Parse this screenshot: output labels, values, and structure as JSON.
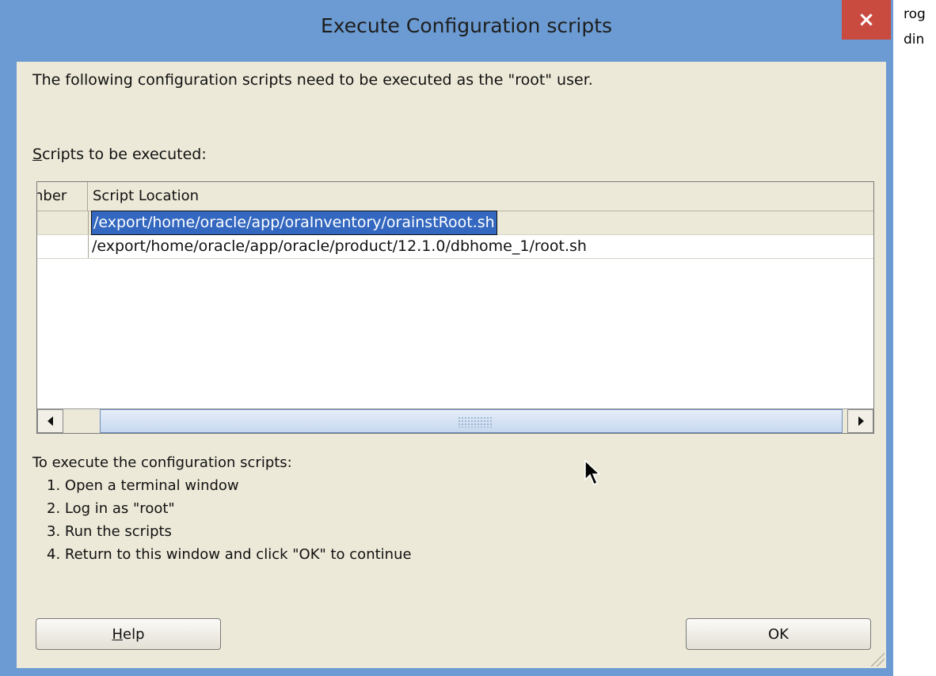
{
  "background_window": {
    "line1": "rog",
    "line2": "din"
  },
  "dialog": {
    "title": "Execute Configuration scripts",
    "close_label": "×",
    "message": "The following configuration scripts need to be executed as the \"root\" user.",
    "scripts_label_mnemonic": "S",
    "scripts_label_rest": "cripts to be executed:",
    "table": {
      "columns": [
        "nber",
        "Script Location"
      ],
      "rows": [
        {
          "number": "",
          "location": "/export/home/oracle/app/oraInventory/orainstRoot.sh",
          "selected": true
        },
        {
          "number": "",
          "location": "/export/home/oracle/app/oracle/product/12.1.0/dbhome_1/root.sh",
          "selected": false
        }
      ]
    },
    "instructions": {
      "heading": "To execute the configuration scripts:",
      "steps": [
        "1. Open a terminal window",
        "2. Log in as \"root\"",
        "3. Run the scripts",
        "4. Return to this window and click \"OK\" to continue"
      ]
    },
    "buttons": {
      "help_mnemonic": "H",
      "help_rest": "elp",
      "ok": "OK"
    }
  },
  "colors": {
    "frame": "#6b9bd2",
    "client": "#ece9d8",
    "close": "#c94b40",
    "selection": "#3468c0"
  },
  "icons": [
    "close-icon",
    "scroll-left-icon",
    "scroll-right-icon",
    "mouse-cursor-icon",
    "resize-grip-icon"
  ]
}
